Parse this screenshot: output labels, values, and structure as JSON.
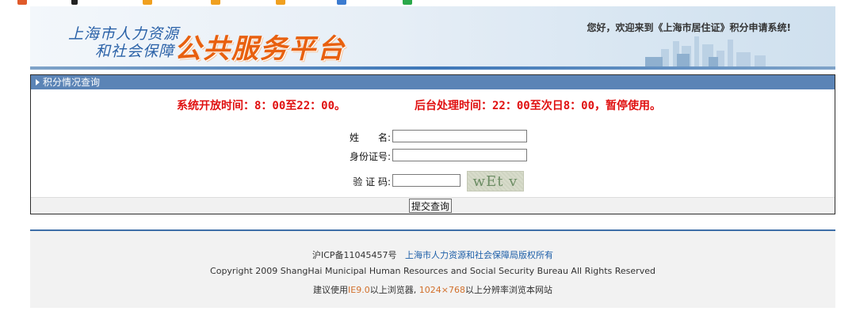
{
  "colors": {
    "banner_blue": "#2b62a8",
    "platform_orange": "#e8600f",
    "header_blue": "#5b84b6",
    "notice_red": "#e01010",
    "footer_link": "#1d5fa8"
  },
  "banner": {
    "org_line1": "上海市人力资源",
    "org_line2": "和社会保障",
    "platform": "公共服务平台",
    "welcome": "您好，欢迎来到《上海市居住证》积分申请系统!"
  },
  "panel": {
    "header": "积分情况查询",
    "notice_open": "系统开放时间：8：00至22：00。",
    "notice_maintenance": "后台处理时间：22：00至次日8：00，暂停使用。",
    "fields": {
      "name_label": "姓　　名:",
      "name_value": "",
      "id_label": "身份证号:",
      "id_value": "",
      "captcha_label": "验 证 码:",
      "captcha_value": "",
      "captcha_image_text": "wEt v"
    },
    "submit_label": "提交查询"
  },
  "footer": {
    "icp": "沪ICP备11045457号",
    "rights": "上海市人力资源和社会保障局版权所有",
    "copyright": "Copyright 2009 ShangHai Municipal Human Resources and Social Security Bureau All Rights Reserved",
    "advice_prefix": "建议使用",
    "advice_browser": "IE9.0",
    "advice_middle": "以上浏览器,",
    "advice_resolution": "1024×768",
    "advice_suffix": "以上分辨率浏览本网站"
  }
}
